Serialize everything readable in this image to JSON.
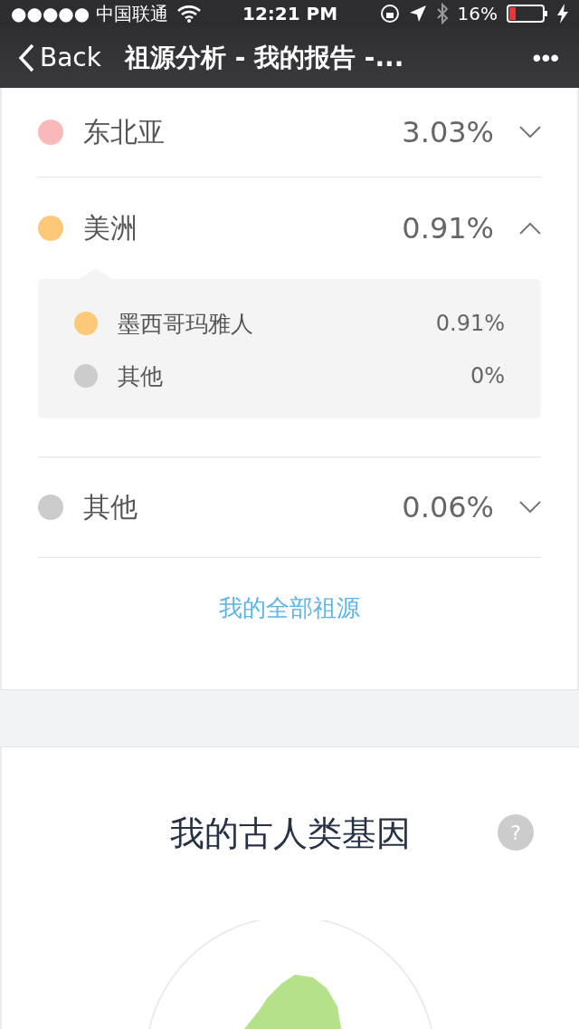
{
  "status_bar": {
    "carrier": "●●●●● 中国联通",
    "time": "12:21 PM",
    "battery": "16%"
  },
  "nav": {
    "back": "Back",
    "title": "祖源分析 - 我的报告 -...",
    "more": "•••"
  },
  "regions": [
    {
      "name": "东北亚",
      "percent": "3.03%",
      "color": "#f9b9bb",
      "expanded": false
    },
    {
      "name": "美洲",
      "percent": "0.91%",
      "color": "#fdc978",
      "expanded": true,
      "children": [
        {
          "name": "墨西哥玛雅人",
          "percent": "0.91%",
          "color": "#fdc978"
        },
        {
          "name": "其他",
          "percent": "0%",
          "color": "#cccccc"
        }
      ]
    },
    {
      "name": "其他",
      "percent": "0.06%",
      "color": "#cccccc",
      "expanded": false
    }
  ],
  "all_link": "我的全部祖源",
  "archaic": {
    "title": "我的古人类基因",
    "help": "?"
  }
}
